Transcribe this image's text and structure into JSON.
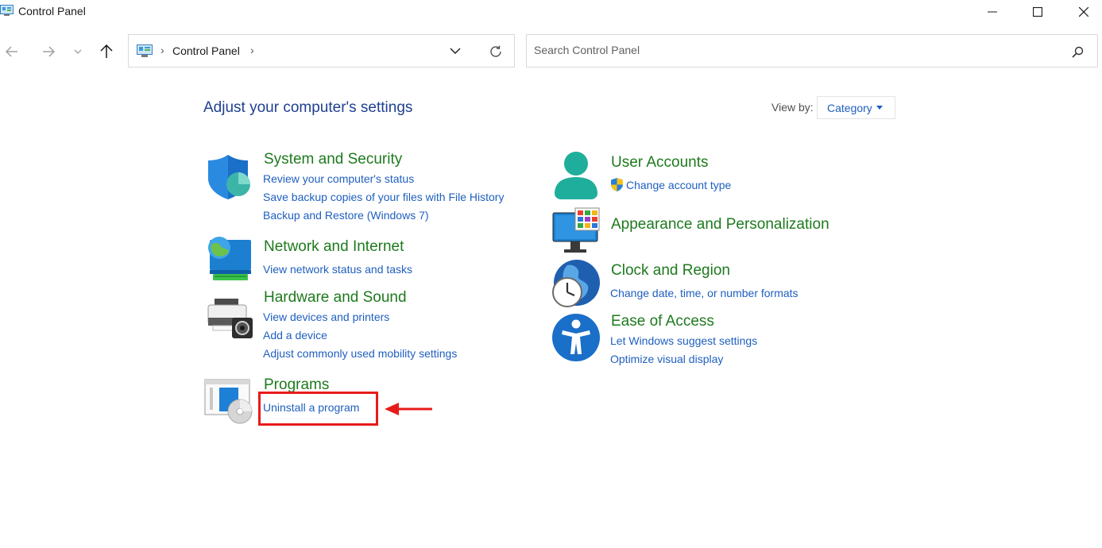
{
  "window": {
    "title": "Control Panel",
    "icon": "control-panel-icon",
    "controls": [
      "minimize-icon",
      "maximize-icon",
      "close-icon"
    ]
  },
  "navigation": {
    "back": "back-arrow-icon",
    "forward": "forward-arrow-icon",
    "recent": "chevron-down-icon",
    "up": "up-arrow-icon"
  },
  "address_bar": {
    "breadcrumb": [
      "Control Panel"
    ],
    "separator": "›",
    "refresh": "refresh-icon"
  },
  "search": {
    "placeholder": "Search Control Panel",
    "value": ""
  },
  "main": {
    "title": "Adjust your computer's settings",
    "view_by_label": "View by:",
    "view_by_value": "Category"
  },
  "categories_left": [
    {
      "title": "System and Security",
      "icon": "shield-icon",
      "links": [
        "Review your computer's status",
        "Save backup copies of your files with File History",
        "Backup and Restore (Windows 7)"
      ]
    },
    {
      "title": "Network and Internet",
      "icon": "network-icon",
      "links": [
        "View network status and tasks"
      ]
    },
    {
      "title": "Hardware and Sound",
      "icon": "printer-icon",
      "links": [
        "View devices and printers",
        "Add a device",
        "Adjust commonly used mobility settings"
      ]
    },
    {
      "title": "Programs",
      "icon": "programs-icon",
      "links": [
        "Uninstall a program"
      ]
    }
  ],
  "categories_right": [
    {
      "title": "User Accounts",
      "icon": "user-icon",
      "links": [
        "Change account type"
      ]
    },
    {
      "title": "Appearance and Personalization",
      "icon": "monitor-icon",
      "links": []
    },
    {
      "title": "Clock and Region",
      "icon": "clock-globe-icon",
      "links": [
        "Change date, time, or number formats"
      ]
    },
    {
      "title": "Ease of Access",
      "icon": "accessibility-icon",
      "links": [
        "Let Windows suggest settings",
        "Optimize visual display"
      ]
    }
  ],
  "colors": {
    "title_blue": "#1f3f8f",
    "category_green": "#1e7a1e",
    "link_blue": "#1f5fbf",
    "annotation_red": "#e81b1b"
  }
}
